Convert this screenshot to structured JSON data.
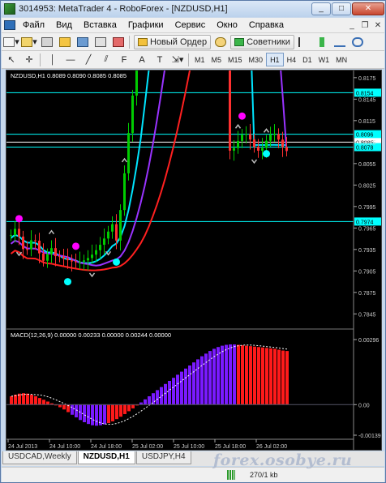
{
  "window": {
    "title": "3014953: MetaTrader 4 - RoboForex - [NZDUSD,H1]"
  },
  "menu": [
    "Файл",
    "Вид",
    "Вставка",
    "Графики",
    "Сервис",
    "Окно",
    "Справка"
  ],
  "toolbar1": {
    "new_order": "Новый Ордер",
    "advisors": "Советники"
  },
  "timeframes": [
    "M1",
    "M5",
    "M15",
    "M30",
    "H1",
    "H4",
    "D1",
    "W1",
    "MN"
  ],
  "active_timeframe": "H1",
  "chart": {
    "header": "NZDUSD,H1  0.8089 0.8090 0.8085 0.8085",
    "price_axis": [
      "0.8175",
      "0.8145",
      "0.8115",
      "0.8085",
      "0.8055",
      "0.8025",
      "0.7995",
      "0.7965",
      "0.7935",
      "0.7905",
      "0.7875",
      "0.7845"
    ],
    "levels": [
      {
        "price": 0.8154,
        "label": "0.8154",
        "color": "#00ffff"
      },
      {
        "price": 0.8096,
        "label": "0.8096",
        "color": "#00ffff"
      },
      {
        "price": 0.8085,
        "label": "0.8085",
        "color": "#ffffff"
      },
      {
        "price": 0.8078,
        "label": "0.8078",
        "color": "#00ffff"
      },
      {
        "price": 0.7974,
        "label": "0.7974",
        "color": "#00ffff"
      }
    ],
    "macd_header": "MACD(12,26,9) 0.00000 0.00233 0.00000 0.00244 0.00000",
    "macd_axis": [
      "0.00296",
      "0.00",
      "-0.00139"
    ],
    "time_axis": [
      "24 Jul 2013",
      "24 Jul 10:00",
      "24 Jul 18:00",
      "25 Jul 02:00",
      "25 Jul 10:00",
      "25 Jul 18:00",
      "26 Jul 02:00"
    ],
    "colors": {
      "bull": "#00cc00",
      "bear": "#ff3030",
      "ma_fast": "#00e5ff",
      "ma_mid": "#9933ff",
      "ma_slow": "#ff2020",
      "macd_pos": "#7a1aff",
      "macd_neg": "#ff1a1a",
      "signal": "#ffffff"
    }
  },
  "chart_data": {
    "type": "candlestick",
    "price_range": [
      0.7825,
      0.8185
    ],
    "macd_range": [
      -0.00139,
      0.00296
    ],
    "bars": 69,
    "macd_values": [
      0.00038,
      0.00045,
      0.0005,
      0.00052,
      0.0005,
      0.00045,
      0.00038,
      0.0003,
      0.00022,
      0.00014,
      6e-05,
      -2e-05,
      -0.00012,
      -0.00022,
      -0.00034,
      -0.00046,
      -0.00058,
      -0.0007,
      -0.0008,
      -0.00088,
      -0.00094,
      -0.00096,
      -0.00094,
      -0.0009,
      -0.00084,
      -0.00076,
      -0.00066,
      -0.00055,
      -0.00043,
      -0.0003,
      -0.00017,
      -4e-05,
      0.0001,
      0.00024,
      0.00038,
      0.00052,
      0.00066,
      0.0008,
      0.00094,
      0.00108,
      0.00122,
      0.00136,
      0.0015,
      0.00164,
      0.00178,
      0.00192,
      0.00206,
      0.0022,
      0.00232,
      0.00244,
      0.00254,
      0.00262,
      0.00268,
      0.00272,
      0.00274,
      0.00274,
      0.00272,
      0.0027,
      0.00268,
      0.00266,
      0.00264,
      0.00262,
      0.0026,
      0.00258,
      0.00256,
      0.00254,
      0.0025,
      0.00246,
      0.00244
    ]
  },
  "tabs": [
    "USDCAD,Weekly",
    "NZDUSD,H1",
    "USDJPY,H4"
  ],
  "active_tab": "NZDUSD,H1",
  "status": {
    "traffic": "270/1 kb"
  },
  "watermark": "forex.osobye.ru"
}
